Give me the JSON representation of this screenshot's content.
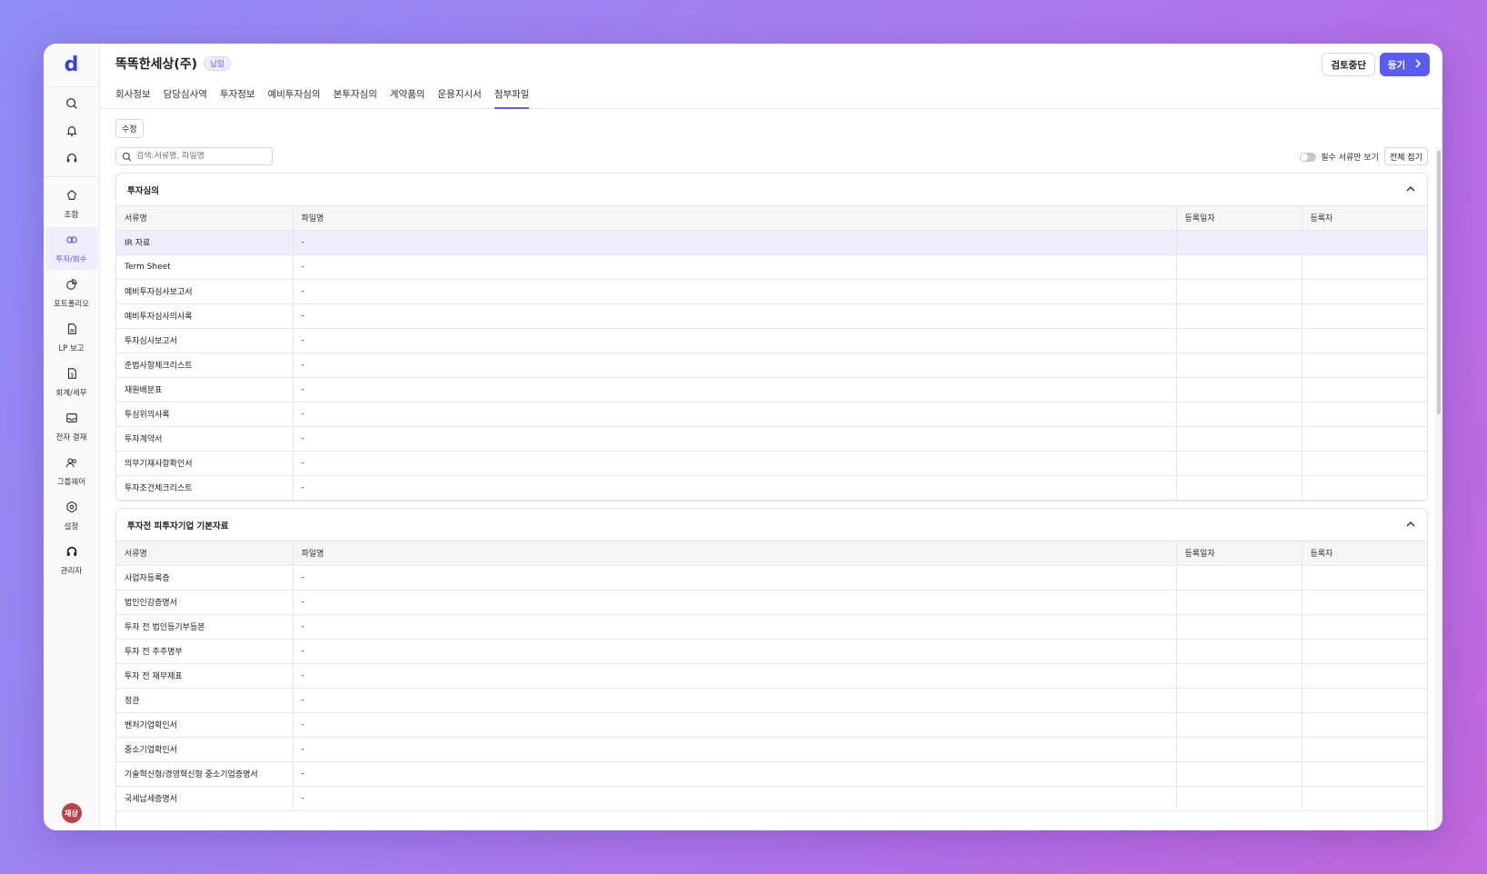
{
  "app": {
    "logo": "d"
  },
  "sidebar": {
    "nav": [
      {
        "label": "조합",
        "icon": "fund-icon"
      },
      {
        "label": "투자/회수",
        "icon": "investment-icon",
        "active": true
      },
      {
        "label": "포트폴리오",
        "icon": "portfolio-icon"
      },
      {
        "label": "LP 보고",
        "icon": "report-icon"
      },
      {
        "label": "회계/세무",
        "icon": "accounting-icon"
      },
      {
        "label": "전자 결재",
        "icon": "approval-icon"
      },
      {
        "label": "그룹웨어",
        "icon": "groupware-icon"
      },
      {
        "label": "설정",
        "icon": "settings-icon"
      },
      {
        "label": "관리자",
        "icon": "admin-icon"
      }
    ],
    "avatar": "재상"
  },
  "header": {
    "company": "똑똑한세상(주)",
    "badge": "납입",
    "review_stop": "검토중단",
    "register": "등기",
    "tabs": [
      "회사정보",
      "담당심사역",
      "투자정보",
      "예비투자심의",
      "본투자심의",
      "계약품의",
      "운용지시서",
      "첨부파일"
    ]
  },
  "toolbar": {
    "edit": "수정",
    "search_placeholder": "검색:서류명, 파일명",
    "required_only": "필수 서류만 보기",
    "collapse_all": "전체 접기"
  },
  "columns": [
    "서류명",
    "파일명",
    "등록일자",
    "등록자"
  ],
  "sections": [
    {
      "title": "투자심의",
      "rows": [
        [
          "IR 자료",
          "-",
          "",
          ""
        ],
        [
          "Term Sheet",
          "-",
          "",
          ""
        ],
        [
          "예비투자심사보고서",
          "-",
          "",
          ""
        ],
        [
          "예비투자심사의사록",
          "-",
          "",
          ""
        ],
        [
          "투자심사보고서",
          "-",
          "",
          ""
        ],
        [
          "준법사항체크리스트",
          "-",
          "",
          ""
        ],
        [
          "재원배분표",
          "-",
          "",
          ""
        ],
        [
          "투심위의사록",
          "-",
          "",
          ""
        ],
        [
          "투자계약서",
          "-",
          "",
          ""
        ],
        [
          "의무기재사항확인서",
          "-",
          "",
          ""
        ],
        [
          "투자조건체크리스트",
          "-",
          "",
          ""
        ]
      ]
    },
    {
      "title": "투자전 피투자기업 기본자료",
      "rows": [
        [
          "사업자등록증",
          "-",
          "",
          ""
        ],
        [
          "법인인감증명서",
          "-",
          "",
          ""
        ],
        [
          "투자 전 법인등기부등본",
          "-",
          "",
          ""
        ],
        [
          "투자 전 주주명부",
          "-",
          "",
          ""
        ],
        [
          "투자 전 재무제표",
          "-",
          "",
          ""
        ],
        [
          "정관",
          "-",
          "",
          ""
        ],
        [
          "벤처기업확인서",
          "-",
          "",
          ""
        ],
        [
          "중소기업확인서",
          "-",
          "",
          ""
        ],
        [
          "기술혁신형/경영혁신형 중소기업증명서",
          "-",
          "",
          ""
        ],
        [
          "국세납세증명서",
          "-",
          "",
          ""
        ]
      ]
    }
  ],
  "colors": {
    "accent": "#5b5bf0",
    "active_bg": "#eeeefc",
    "avatar": "#b8434a"
  }
}
